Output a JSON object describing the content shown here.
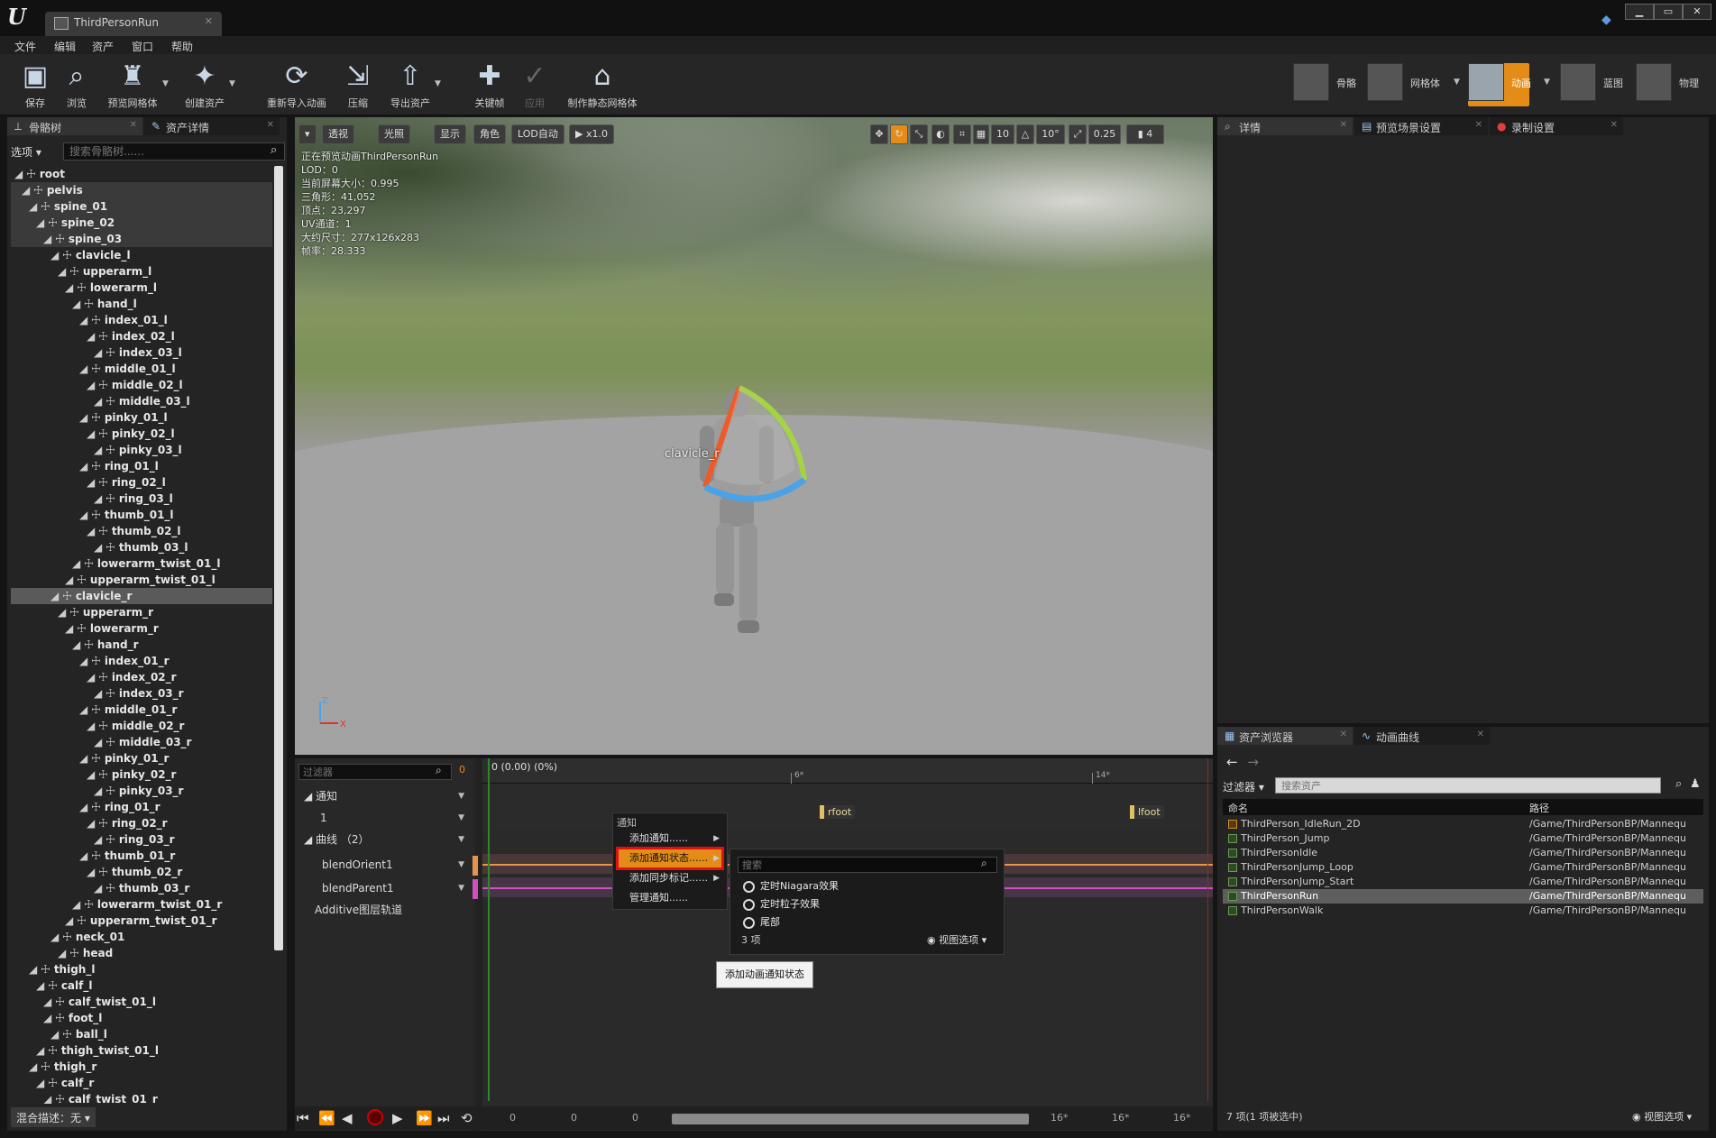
{
  "window": {
    "tab_title": "ThirdPersonRun",
    "logo": "U",
    "controls": [
      "▁",
      "▭",
      "✕"
    ]
  },
  "menu": [
    "文件",
    "编辑",
    "资产",
    "窗口",
    "帮助"
  ],
  "toolbar": {
    "tools": [
      {
        "label": "保存",
        "icon": "save-icon"
      },
      {
        "label": "浏览",
        "icon": "browse-icon"
      },
      {
        "label": "预览网格体",
        "icon": "preview-mesh-icon"
      },
      {
        "label": "创建资产",
        "icon": "create-asset-icon"
      },
      {
        "label": "重新导入动画",
        "icon": "reimport-icon"
      },
      {
        "label": "压缩",
        "icon": "compress-icon"
      },
      {
        "label": "导出资产",
        "icon": "export-icon"
      },
      {
        "label": "关键帧",
        "icon": "key-icon"
      },
      {
        "label": "应用",
        "icon": "apply-icon",
        "disabled": true
      },
      {
        "label": "制作静态网格体",
        "icon": "static-mesh-icon"
      }
    ],
    "modes": [
      {
        "label": "骨骼",
        "active": false
      },
      {
        "label": "网格体",
        "active": false
      },
      {
        "label": "动画",
        "active": true
      },
      {
        "label": "蓝图",
        "active": false
      },
      {
        "label": "物理",
        "active": false
      }
    ]
  },
  "skeleton_panel": {
    "tabs": [
      "骨骼树",
      "资产详情"
    ],
    "options_label": "选项",
    "search_placeholder": "搜索骨骼树......",
    "bones": [
      {
        "name": "root",
        "depth": 0
      },
      {
        "name": "pelvis",
        "depth": 1
      },
      {
        "name": "spine_01",
        "depth": 2
      },
      {
        "name": "spine_02",
        "depth": 3
      },
      {
        "name": "spine_03",
        "depth": 4
      },
      {
        "name": "clavicle_l",
        "depth": 5
      },
      {
        "name": "upperarm_l",
        "depth": 6
      },
      {
        "name": "lowerarm_l",
        "depth": 7
      },
      {
        "name": "hand_l",
        "depth": 8
      },
      {
        "name": "index_01_l",
        "depth": 9
      },
      {
        "name": "index_02_l",
        "depth": 10
      },
      {
        "name": "index_03_l",
        "depth": 11
      },
      {
        "name": "middle_01_l",
        "depth": 9
      },
      {
        "name": "middle_02_l",
        "depth": 10
      },
      {
        "name": "middle_03_l",
        "depth": 11
      },
      {
        "name": "pinky_01_l",
        "depth": 9
      },
      {
        "name": "pinky_02_l",
        "depth": 10
      },
      {
        "name": "pinky_03_l",
        "depth": 11
      },
      {
        "name": "ring_01_l",
        "depth": 9
      },
      {
        "name": "ring_02_l",
        "depth": 10
      },
      {
        "name": "ring_03_l",
        "depth": 11
      },
      {
        "name": "thumb_01_l",
        "depth": 9
      },
      {
        "name": "thumb_02_l",
        "depth": 10
      },
      {
        "name": "thumb_03_l",
        "depth": 11
      },
      {
        "name": "lowerarm_twist_01_l",
        "depth": 8
      },
      {
        "name": "upperarm_twist_01_l",
        "depth": 7
      },
      {
        "name": "clavicle_r",
        "depth": 5,
        "selected": true
      },
      {
        "name": "upperarm_r",
        "depth": 6
      },
      {
        "name": "lowerarm_r",
        "depth": 7
      },
      {
        "name": "hand_r",
        "depth": 8
      },
      {
        "name": "index_01_r",
        "depth": 9
      },
      {
        "name": "index_02_r",
        "depth": 10
      },
      {
        "name": "index_03_r",
        "depth": 11
      },
      {
        "name": "middle_01_r",
        "depth": 9
      },
      {
        "name": "middle_02_r",
        "depth": 10
      },
      {
        "name": "middle_03_r",
        "depth": 11
      },
      {
        "name": "pinky_01_r",
        "depth": 9
      },
      {
        "name": "pinky_02_r",
        "depth": 10
      },
      {
        "name": "pinky_03_r",
        "depth": 11
      },
      {
        "name": "ring_01_r",
        "depth": 9
      },
      {
        "name": "ring_02_r",
        "depth": 10
      },
      {
        "name": "ring_03_r",
        "depth": 11
      },
      {
        "name": "thumb_01_r",
        "depth": 9
      },
      {
        "name": "thumb_02_r",
        "depth": 10
      },
      {
        "name": "thumb_03_r",
        "depth": 11
      },
      {
        "name": "lowerarm_twist_01_r",
        "depth": 8
      },
      {
        "name": "upperarm_twist_01_r",
        "depth": 7
      },
      {
        "name": "neck_01",
        "depth": 5
      },
      {
        "name": "head",
        "depth": 6
      },
      {
        "name": "thigh_l",
        "depth": 2
      },
      {
        "name": "calf_l",
        "depth": 3
      },
      {
        "name": "calf_twist_01_l",
        "depth": 4
      },
      {
        "name": "foot_l",
        "depth": 4
      },
      {
        "name": "ball_l",
        "depth": 5
      },
      {
        "name": "thigh_twist_01_l",
        "depth": 3
      },
      {
        "name": "thigh_r",
        "depth": 2
      },
      {
        "name": "calf_r",
        "depth": 3
      },
      {
        "name": "calf_twist_01_r",
        "depth": 4
      }
    ],
    "blend_label": "混合描述：无"
  },
  "viewport": {
    "buttons_left": [
      "透视",
      "光照",
      "显示",
      "角色",
      "LOD自动",
      "x1.0"
    ],
    "buttons_right": [
      "10",
      "10°",
      "0.25",
      "4"
    ],
    "info_lines": [
      "正在预览动画ThirdPersonRun",
      "LOD：0",
      "当前屏幕大小：0.995",
      "三角形：41,052",
      "顶点：23,297",
      "UV通道：1",
      "大约尺寸：277x126x283",
      "帧率：28.333"
    ],
    "bone_label": "clavicle_r",
    "axis_z": "Z",
    "axis_x": "X"
  },
  "sequencer": {
    "filter_placeholder": "过滤器",
    "frame_start": "0",
    "time_readout": "0 (0.00) (0%)",
    "ticks": [
      "6*",
      "14*"
    ],
    "tracks": {
      "notify": "通知",
      "notify_track": "1",
      "curves": "曲线 （2）",
      "curve1": "blendOrient1",
      "curve2": "blendParent1",
      "additive": "Additive图层轨道"
    },
    "markers": [
      "rfoot",
      "lfoot"
    ],
    "transport_nums": [
      "0",
      "0",
      "0",
      "16*",
      "16*",
      "16*"
    ]
  },
  "context_menu": {
    "header": "通知",
    "items": [
      {
        "label": "添加通知......",
        "submenu": true
      },
      {
        "label": "添加通知状态......",
        "submenu": true,
        "hot": true
      },
      {
        "label": "添加同步标记......",
        "submenu": true
      },
      {
        "label": "管理通知......",
        "submenu": false
      }
    ],
    "sub": {
      "search_placeholder": "搜索",
      "items": [
        "定时Niagara效果",
        "定时粒子效果",
        "尾部"
      ],
      "count": "3 项",
      "view_options": "视图选项"
    },
    "tooltip": "添加动画通知状态"
  },
  "details_panel": {
    "tabs": [
      "详情",
      "预览场景设置",
      "录制设置"
    ]
  },
  "asset_browser": {
    "tabs": [
      "资产浏览器",
      "动画曲线"
    ],
    "filter_label": "过滤器",
    "search_placeholder": "搜索资产",
    "col_name": "命名",
    "col_path": "路径",
    "rows": [
      {
        "name": "ThirdPerson_IdleRun_2D",
        "path": "/Game/ThirdPersonBP/Mannequ",
        "type": "blend"
      },
      {
        "name": "ThirdPerson_Jump",
        "path": "/Game/ThirdPersonBP/Mannequ",
        "type": "anim"
      },
      {
        "name": "ThirdPersonIdle",
        "path": "/Game/ThirdPersonBP/Mannequ",
        "type": "anim"
      },
      {
        "name": "ThirdPersonJump_Loop",
        "path": "/Game/ThirdPersonBP/Mannequ",
        "type": "anim"
      },
      {
        "name": "ThirdPersonJump_Start",
        "path": "/Game/ThirdPersonBP/Mannequ",
        "type": "anim"
      },
      {
        "name": "ThirdPersonRun",
        "path": "/Game/ThirdPersonBP/Mannequ",
        "type": "anim",
        "selected": true
      },
      {
        "name": "ThirdPersonWalk",
        "path": "/Game/ThirdPersonBP/Mannequ",
        "type": "anim"
      }
    ],
    "footer": "7 项(1 项被选中)",
    "view_options": "视图选项"
  },
  "colors": {
    "accent_orange": "#e48c17",
    "highlight_red": "#e01010",
    "gizmo_red": "#f05a28",
    "gizmo_green": "#a5d443",
    "gizmo_blue": "#4aa3e8",
    "curve1": "#e8924a",
    "curve2": "#d050c0"
  }
}
